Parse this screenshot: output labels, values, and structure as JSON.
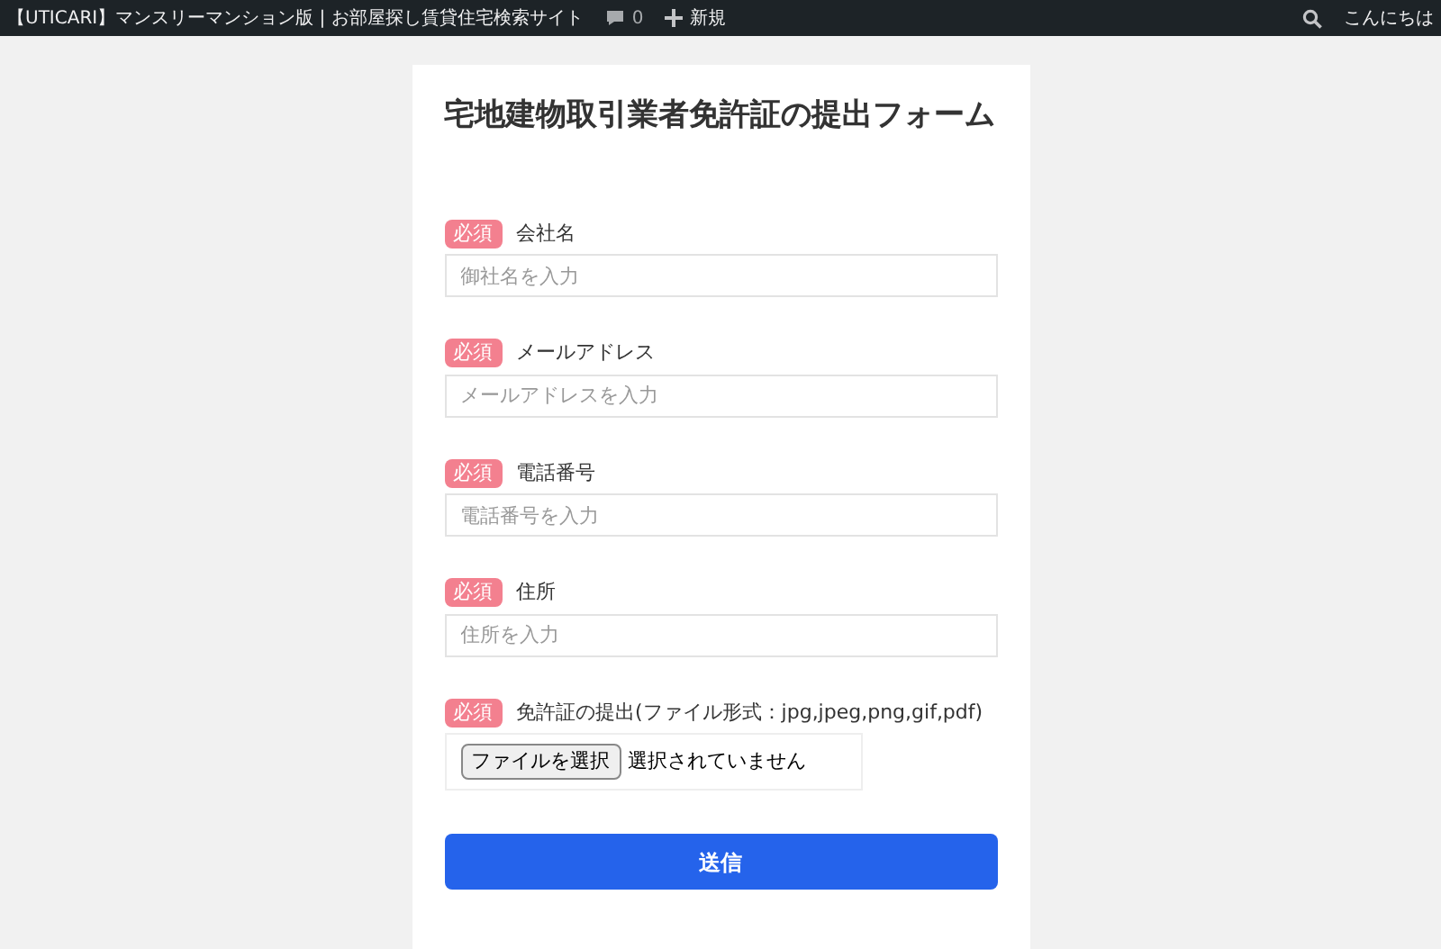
{
  "admin_bar": {
    "site_title": "【UTICARI】マンスリーマンション版 | お部屋探し賃貸住宅検索サイト",
    "comments_count": "0",
    "new_label": "新規",
    "greeting": "こんにちは"
  },
  "form": {
    "title": "宅地建物取引業者免許証の提出フォーム",
    "fields": [
      {
        "kind": "text",
        "badge": "必須",
        "label": "会社名",
        "placeholder": "御社名を入力"
      },
      {
        "kind": "text",
        "badge": "必須",
        "label": "メールアドレス",
        "placeholder": "メールアドレスを入力"
      },
      {
        "kind": "text",
        "badge": "必須",
        "label": "電話番号",
        "placeholder": "電話番号を入力"
      },
      {
        "kind": "text",
        "badge": "必須",
        "label": "住所",
        "placeholder": "住所を入力"
      },
      {
        "kind": "file",
        "badge": "必須",
        "label": "免許証の提出(ファイル形式：jpg,jpeg,png,gif,pdf)",
        "button": "ファイルを選択",
        "status": "選択されていません"
      }
    ],
    "submit": "送信"
  }
}
